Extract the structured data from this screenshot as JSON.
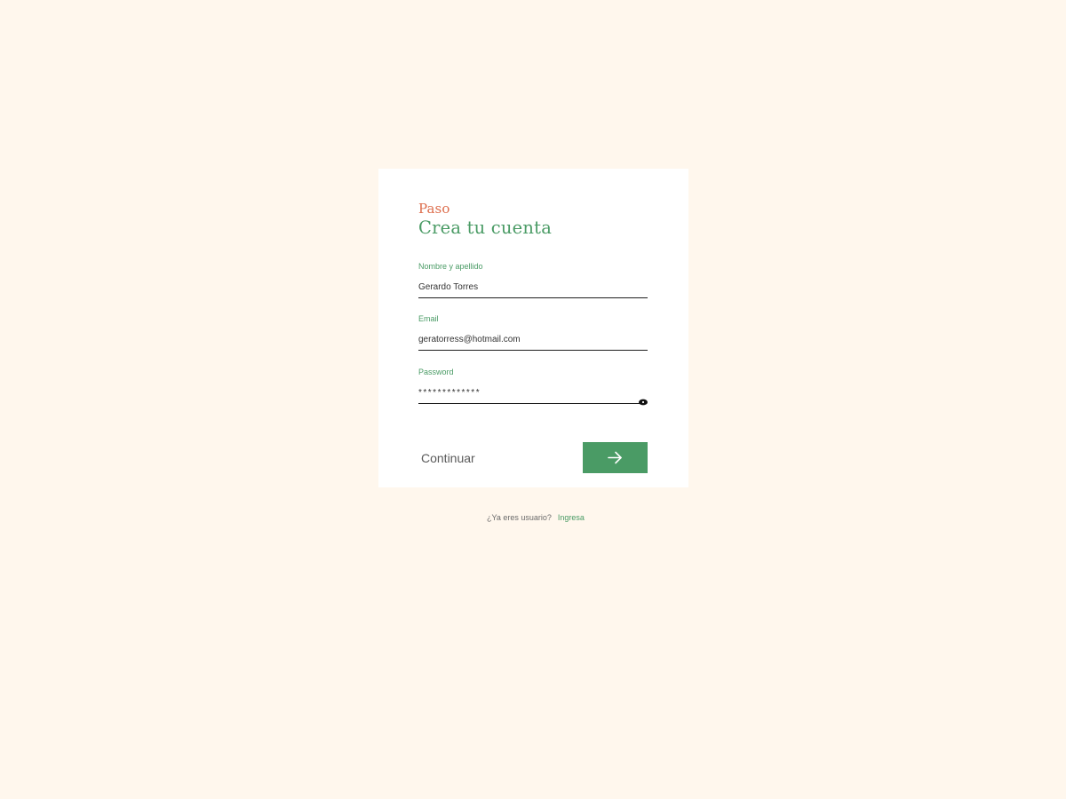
{
  "brand": "Paso",
  "title": "Crea tu cuenta",
  "form": {
    "name": {
      "label": "Nombre y apellido",
      "value": "Gerardo Torres"
    },
    "email": {
      "label": "Email",
      "value": "geratorress@hotmail.com"
    },
    "password": {
      "label": "Password",
      "value": "*************",
      "toggle_icon": "eye-icon"
    }
  },
  "submit": {
    "label": "Continuar",
    "icon": "arrow-right-icon"
  },
  "footer": {
    "question": "¿Ya eres usuario?",
    "link": "Ingresa"
  },
  "colors": {
    "background": "#fff7ed",
    "card": "#ffffff",
    "accent_green": "#4a9b65",
    "accent_orange": "#dd6d4c",
    "text_dark": "#1e1e1e"
  }
}
